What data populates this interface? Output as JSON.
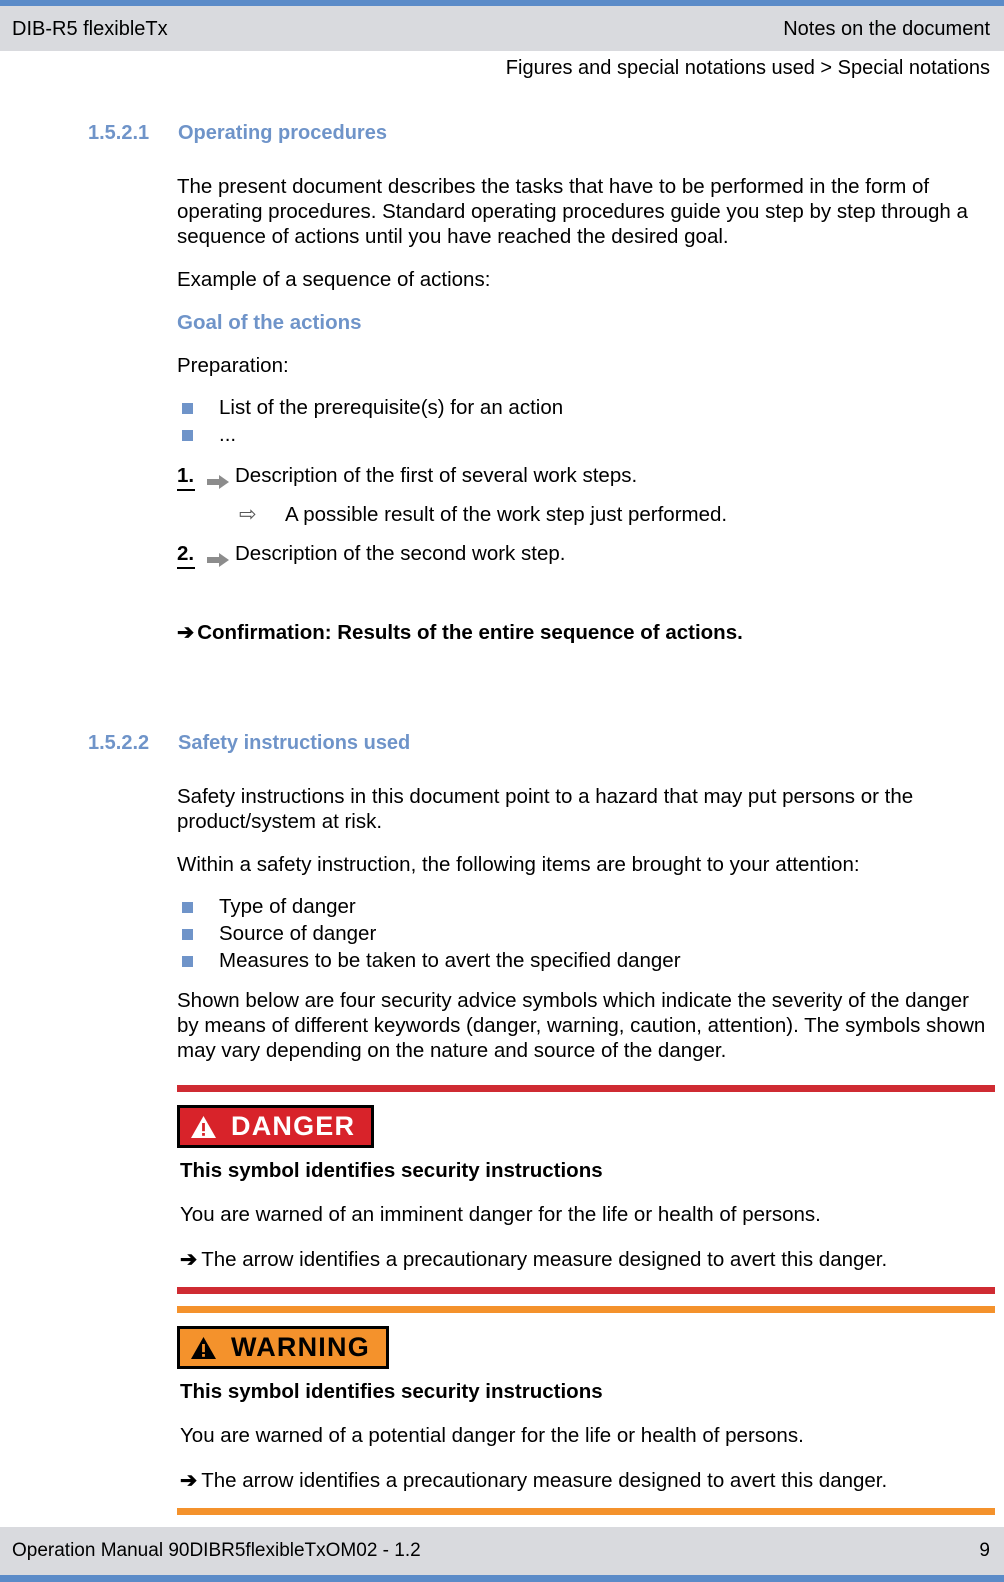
{
  "header": {
    "product": "DIB-R5 flexibleTx",
    "chapter": "Notes on the document",
    "breadcrumb": "Figures and special notations used > Special notations"
  },
  "footer": {
    "manual": "Operation Manual 90DIBR5flexibleTxOM02 - 1.2",
    "page": "9"
  },
  "colors": {
    "accent_blue": "#6f94c9",
    "rule_blue": "#5b8bc8",
    "band_gray": "#d9dade",
    "danger_red": "#d8232a",
    "rule_red": "#cf2b32",
    "warning_orange": "#f4922c"
  },
  "sections": [
    {
      "number": "1.5.2.1",
      "title": "Operating procedures",
      "intro": "The present document describes the tasks that have to be performed in the form of operating procedures. Standard operating procedures guide you step by step through a sequence of actions until you have reached the desired goal.",
      "example_lead": "Example of a sequence of actions:",
      "goal_heading": "Goal of the actions",
      "preparation_label": "Preparation:",
      "prerequisites": [
        "List of the prerequisite(s) for an action",
        "..."
      ],
      "steps": [
        {
          "number": "1.",
          "text": "Description of the first of several work steps."
        },
        {
          "number": "2.",
          "text": "Description of the second work step."
        }
      ],
      "step_result": {
        "arrow": "⇨",
        "text": "A possible result of the work step just performed."
      },
      "confirmation": {
        "arrow": "➔",
        "text": "Confirmation: Results of the entire sequence of actions."
      }
    },
    {
      "number": "1.5.2.2",
      "title": "Safety instructions used",
      "intro": "Safety instructions in this document point to a hazard that may put persons or the product/system at risk.",
      "items_lead": "Within a safety instruction, the following items are brought to your attention:",
      "items": [
        "Type of danger",
        "Source of danger",
        "Measures to be taken to avert the specified danger"
      ],
      "symbols_note": "Shown below are four security advice symbols which indicate the severity of the danger by means of different keywords (danger, warning, caution, attention). The symbols shown may vary depending on the nature and source of the danger."
    }
  ],
  "hazards": [
    {
      "keyword": "DANGER",
      "icon": "warning-triangle-icon",
      "title": "This symbol identifies security instructions",
      "description": "You are warned of an imminent danger for the life or health of persons.",
      "measure_arrow": "➔",
      "measure": "The arrow identifies a precautionary measure designed to avert this danger."
    },
    {
      "keyword": "WARNING",
      "icon": "warning-triangle-icon",
      "title": "This symbol identifies security instructions",
      "description": "You are warned of a potential danger for the life or health of persons.",
      "measure_arrow": "➔",
      "measure": "The arrow identifies a precautionary measure designed to avert this danger."
    }
  ]
}
